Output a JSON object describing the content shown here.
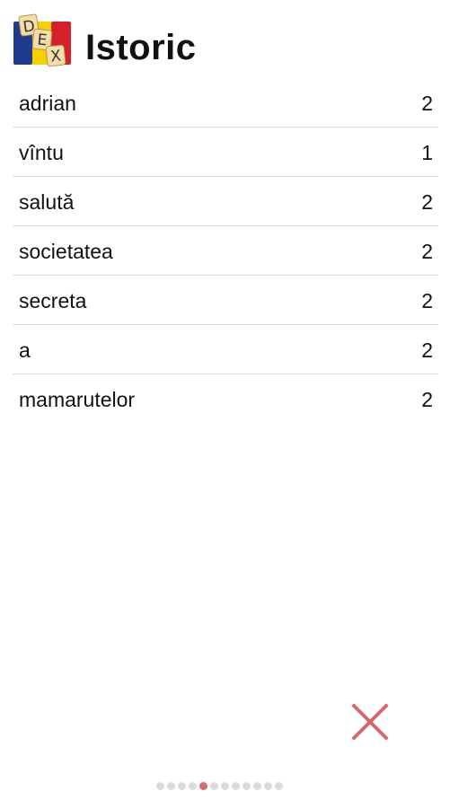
{
  "header": {
    "title": "Istoric",
    "logo_letters": [
      "D",
      "E",
      "X"
    ],
    "logo_colors": {
      "blue": "#1d3c8f",
      "yellow": "#f6d000",
      "red": "#d51f2a",
      "tile": "#f3deaa"
    }
  },
  "history": {
    "items": [
      {
        "word": "adrian",
        "count": "2"
      },
      {
        "word": "vîntu",
        "count": "1"
      },
      {
        "word": "salută",
        "count": "2"
      },
      {
        "word": "societatea",
        "count": "2"
      },
      {
        "word": "secreta",
        "count": "2"
      },
      {
        "word": "a",
        "count": "2"
      },
      {
        "word": "mamarutelor",
        "count": "2"
      }
    ]
  },
  "clear_button": {
    "icon": "close-icon",
    "color": "#d9666b"
  },
  "pager": {
    "total": 12,
    "active": 4,
    "active_color": "#d96b6b",
    "inactive_color": "#dcdcdc"
  }
}
